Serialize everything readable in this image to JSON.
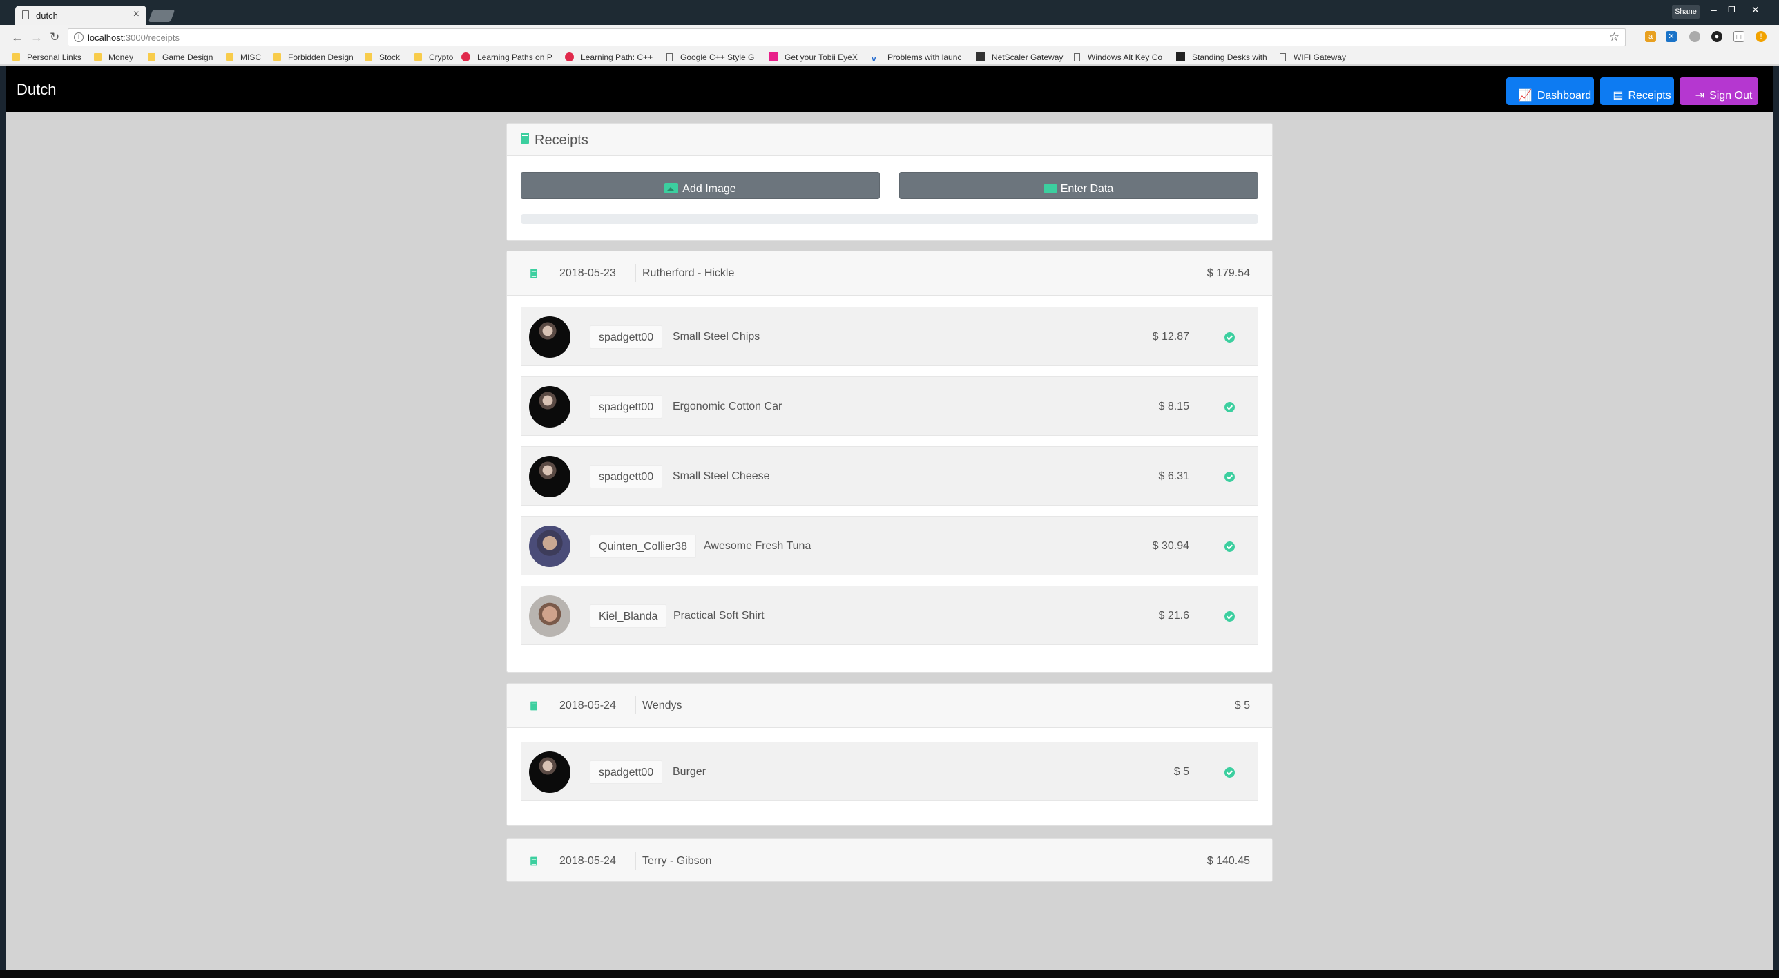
{
  "browser": {
    "tab_title": "dutch",
    "url_host": "localhost",
    "url_path": ":3000/receipts",
    "profile_name": "Shane",
    "bookmarks": [
      {
        "label": "Personal Links",
        "kind": "folder"
      },
      {
        "label": "Money",
        "kind": "folder"
      },
      {
        "label": "Game Design",
        "kind": "folder"
      },
      {
        "label": "MISC",
        "kind": "folder"
      },
      {
        "label": "Forbidden Design",
        "kind": "folder"
      },
      {
        "label": "Stock",
        "kind": "folder"
      },
      {
        "label": "Crypto",
        "kind": "folder"
      },
      {
        "label": "Learning Paths on P",
        "kind": "circle"
      },
      {
        "label": "Learning Path: C++",
        "kind": "circle"
      },
      {
        "label": "Google C++ Style G",
        "kind": "page"
      },
      {
        "label": "Get your Tobii EyeX",
        "kind": "pink"
      },
      {
        "label": "Problems with launc",
        "kind": "v"
      },
      {
        "label": "NetScaler Gateway",
        "kind": "dark"
      },
      {
        "label": "Windows Alt Key Co",
        "kind": "page"
      },
      {
        "label": "Standing Desks with",
        "kind": "dark"
      },
      {
        "label": "WIFI Gateway",
        "kind": "page"
      }
    ]
  },
  "app": {
    "brand": "Dutch",
    "nav": {
      "dashboard": "Dashboard",
      "receipts": "Receipts",
      "sign_out": "Sign Out"
    },
    "colors": {
      "primary": "#0d7bf2",
      "signout": "#b537d0",
      "accent": "#3ccf9f",
      "action": "#6c757d"
    }
  },
  "upload": {
    "title": "Receipts",
    "add_image": "Add Image",
    "enter_data": "Enter Data",
    "progress": 0
  },
  "receipts": [
    {
      "date": "2018-05-23",
      "store": "Rutherford - Hickle",
      "total": "$ 179.54",
      "items": [
        {
          "user": "spadgett00",
          "name": "Small Steel Chips",
          "price": "$ 12.87"
        },
        {
          "user": "spadgett00",
          "name": "Ergonomic Cotton Car",
          "price": "$ 8.15"
        },
        {
          "user": "spadgett00",
          "name": "Small Steel Cheese",
          "price": "$ 6.31"
        },
        {
          "user": "Quinten_Collier38",
          "name": "Awesome Fresh Tuna",
          "price": "$ 30.94"
        },
        {
          "user": "Kiel_Blanda",
          "name": "Practical Soft Shirt",
          "price": "$ 21.6"
        }
      ]
    },
    {
      "date": "2018-05-24",
      "store": "Wendys",
      "total": "$ 5",
      "items": [
        {
          "user": "spadgett00",
          "name": "Burger",
          "price": "$ 5"
        }
      ]
    },
    {
      "date": "2018-05-24",
      "store": "Terry - Gibson",
      "total": "$ 140.45",
      "items": []
    }
  ]
}
